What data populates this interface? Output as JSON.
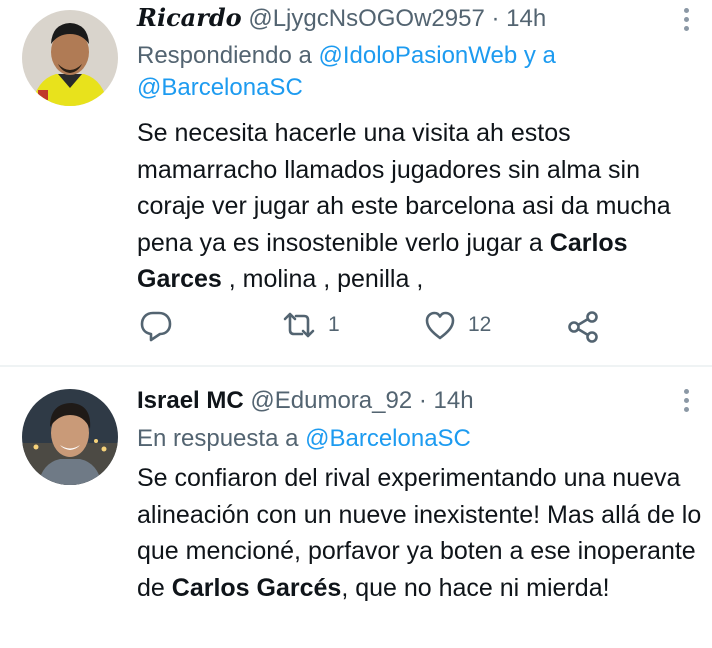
{
  "tweets": [
    {
      "name": "Ricardo",
      "handle": "@LjygcNsOGOw2957",
      "sep": "·",
      "time": "14h",
      "reply_prefix": "Respondiendo a ",
      "reply_mention_1": "@IdoloPasionWeb",
      "reply_join": " y a ",
      "reply_mention_2": "@BarcelonaSC",
      "text_1": "Se necesita hacerle una visita ah estos mamarracho llamados jugadores sin alma sin coraje ver jugar ah este barcelona asi da mucha pena ya es insostenible verlo jugar a ",
      "text_bold": "Carlos Garces",
      "text_2": " , molina , penilla ,",
      "replies_icon": "reply-icon",
      "retweets": "1",
      "likes": "12"
    },
    {
      "name": "Israel MC",
      "handle": "@Edumora_92",
      "sep": "·",
      "time": "14h",
      "reply_prefix": "En respuesta a ",
      "reply_mention_1": "@BarcelonaSC",
      "text_1": "Se confiaron del rival experimentando una nueva alineación con un nueve inexistente! Mas allá de lo que mencioné, porfavor ya boten a ese inoperante de ",
      "text_bold": "Carlos Garcés",
      "text_2": ", que no hace ni mierda!"
    }
  ],
  "colors": {
    "accent": "#1d9bf0",
    "secondary": "#536471",
    "text": "#0f1419"
  }
}
